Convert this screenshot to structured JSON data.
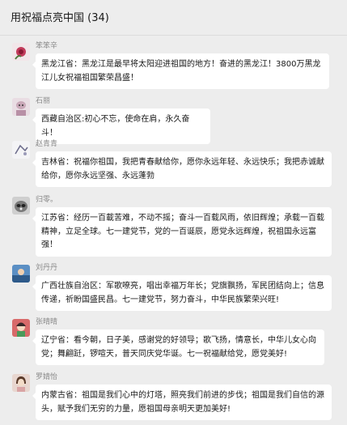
{
  "header": {
    "title": "用祝福点亮中国 (34)"
  },
  "messages": [
    {
      "sender": "笨笨辛",
      "avatar_icon": "flower-avatar-icon",
      "text": "黑龙江省：黑龙江是最早将太阳迎进祖国的地方！奋进的黑龙江！3800万黑龙江儿女祝福祖国繁荣昌盛！"
    },
    {
      "sender": "石丽",
      "avatar_icon": "cartoon-avatar-icon",
      "text": "西藏自治区:初心不忘，使命在肩，永久奋斗！"
    },
    {
      "sender": "赵青青",
      "avatar_icon": "sketch-avatar-icon",
      "text": "吉林省：祝福你祖国，我把青春献给你，愿你永远年轻、永远快乐；我把赤诚献给你，愿你永远坚强、永远蓬勃"
    },
    {
      "sender": "归零。",
      "avatar_icon": "raccoon-avatar-icon",
      "text": "江苏省：经历一百載苦难，不动不摇；奋斗一百载风雨，依旧辉煌；承载一百载精神，立足全球。七一建党节，党的一百诞辰，愿党永远辉煌，祝祖国永远富强！"
    },
    {
      "sender": "刘丹丹",
      "avatar_icon": "photo-avatar-icon",
      "text": "广西壮族自治区：军歌嘹亮，唱出幸福万年长；党旗飘扬，军民团结向上；信息传递，祈盼国盛民昌。七一建党节，努力奋斗，中华民族繁荣兴旺!"
    },
    {
      "sender": "张晴晴",
      "avatar_icon": "anime-avatar-icon",
      "text": "辽宁省：看今朝，日子美，感谢党的好领导；歌飞扬，情意长，中华儿女心向党；舞翩跹，锣喧天，普天同庆党华诞。七一祝福献给党，愿党美好!"
    },
    {
      "sender": "罗婧怡",
      "avatar_icon": "girl-avatar-icon",
      "text": "内蒙古省：祖国是我们心中的灯塔，照亮我们前进的步伐；祖国是我们自信的源头，赋予我们无穷的力量，愿祖国母亲明天更加美好!"
    }
  ]
}
